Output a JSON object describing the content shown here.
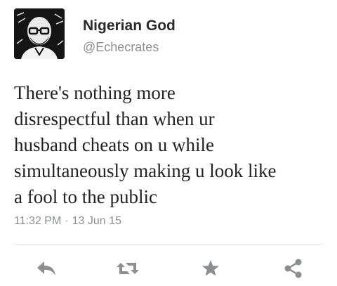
{
  "user": {
    "display_name": "Nigerian God",
    "handle": "@Echecrates"
  },
  "tweet": {
    "lines": [
      "There's nothing more",
      "disrespectful than when ur",
      "husband cheats on u while",
      "simultaneously making u look like",
      "a fool to the public"
    ],
    "time": "11:32 PM",
    "separator": "·",
    "date": "13 Jun 15"
  },
  "actions": [
    "reply-icon",
    "retweet-icon",
    "favorite-icon",
    "share-icon"
  ],
  "colors": {
    "icon": "#8a8f94",
    "text": "#222222",
    "meta": "#8a8f94"
  }
}
